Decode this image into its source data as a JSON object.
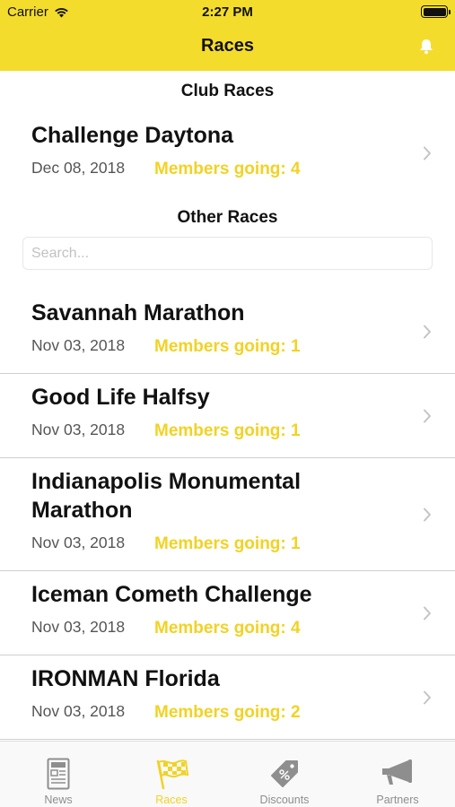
{
  "status_bar": {
    "carrier": "Carrier",
    "time": "2:27 PM"
  },
  "nav": {
    "title": "Races",
    "action_icon": "bell-icon"
  },
  "club_section": {
    "title": "Club Races",
    "races": [
      {
        "name": "Challenge Daytona",
        "date": "Dec 08, 2018",
        "going": "Members going: 4"
      }
    ]
  },
  "other_section": {
    "title": "Other Races",
    "search_placeholder": "Search...",
    "races": [
      {
        "name": "Savannah Marathon",
        "date": "Nov 03, 2018",
        "going": "Members going: 1"
      },
      {
        "name": "Good Life Halfsy",
        "date": "Nov 03, 2018",
        "going": "Members going: 1"
      },
      {
        "name": "Indianapolis Monumental Marathon",
        "date": "Nov 03, 2018",
        "going": "Members going: 1"
      },
      {
        "name": "Iceman Cometh Challenge",
        "date": "Nov 03, 2018",
        "going": "Members going: 4"
      },
      {
        "name": "IRONMAN Florida",
        "date": "Nov 03, 2018",
        "going": "Members going: 2"
      }
    ]
  },
  "tabs": [
    {
      "label": "News",
      "icon": "news-icon",
      "active": false
    },
    {
      "label": "Races",
      "icon": "checkered-flag-icon",
      "active": true
    },
    {
      "label": "Discounts",
      "icon": "tag-icon",
      "active": false
    },
    {
      "label": "Partners",
      "icon": "megaphone-icon",
      "active": false
    }
  ],
  "colors": {
    "accent": "#f4dc2c",
    "going_text": "#f2d224",
    "inactive_tab": "#8e8e8e"
  }
}
